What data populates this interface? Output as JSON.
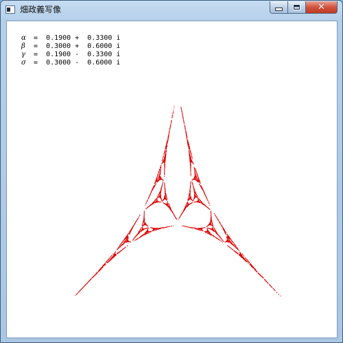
{
  "window": {
    "title": "畑政義写像"
  },
  "params": [
    {
      "symbol": "α",
      "text": " =  0.1900 +  0.3300 i"
    },
    {
      "symbol": "β",
      "text": " =  0.3000 +  0.6000 i"
    },
    {
      "symbol": "γ",
      "text": " =  0.1900 -  0.3300 i"
    },
    {
      "symbol": "σ",
      "text": " =  0.3000 -  0.6000 i"
    }
  ],
  "fractal": {
    "color": "#e00000"
  },
  "colors": {
    "client_bg": "#ffffff",
    "close_button": "#c13a22"
  }
}
